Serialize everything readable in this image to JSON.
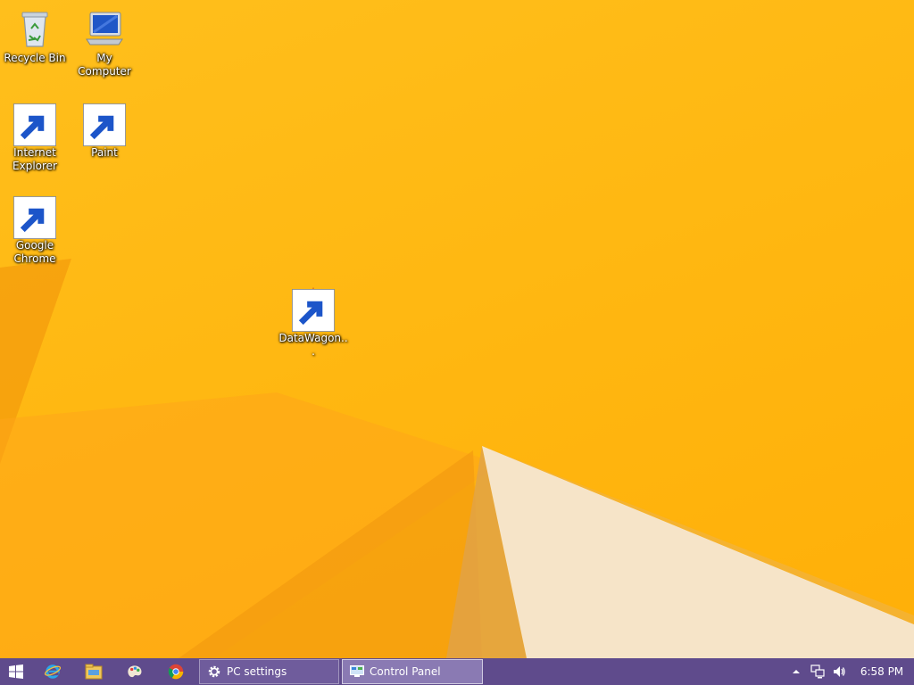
{
  "desktop": {
    "icons": [
      {
        "label": "Recycle Bin"
      },
      {
        "label": "My Computer"
      },
      {
        "label": "Internet Explorer"
      },
      {
        "label": "Paint"
      },
      {
        "label": "Google Chrome"
      },
      {
        "label": "DataWagon..."
      }
    ]
  },
  "taskbar": {
    "start_icon": "windows-logo-icon",
    "pinned": [
      {
        "icon": "internet-explorer-icon"
      },
      {
        "icon": "file-explorer-icon"
      },
      {
        "icon": "paint-icon"
      },
      {
        "icon": "chrome-icon"
      }
    ],
    "windows": [
      {
        "label": "PC settings",
        "icon": "gear-icon"
      },
      {
        "label": "Control Panel",
        "icon": "control-panel-icon"
      }
    ],
    "tray": {
      "icons": [
        "show-hidden-icons-chevron",
        "network-icon",
        "volume-icon"
      ],
      "time": "6:58 PM"
    }
  },
  "colors": {
    "wallpaper": "#ffb812",
    "taskbar": "#5f4b8c",
    "active_window_button": "#8a7ab3"
  }
}
